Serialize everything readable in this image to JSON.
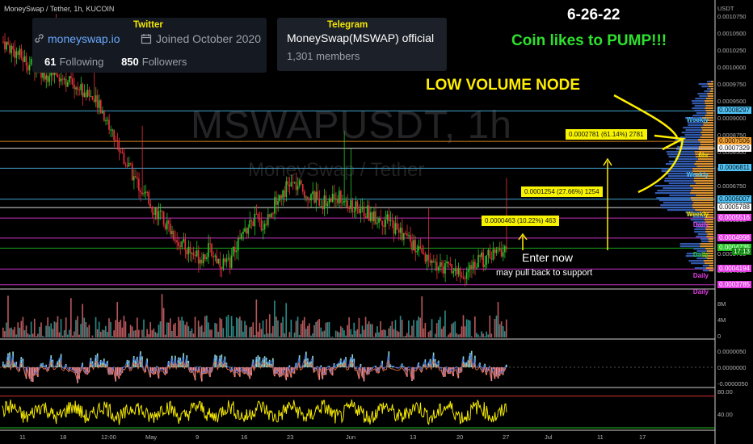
{
  "header": {
    "title": "MoneySwap / Tether, 1h, KUCOIN"
  },
  "twitter": {
    "label": "Twitter",
    "link": "moneyswap.io",
    "joined": "Joined October 2020",
    "following_count": "61",
    "following_label": "Following",
    "followers_count": "850",
    "followers_label": "Followers"
  },
  "telegram": {
    "label": "Telegram",
    "name": "MoneySwap(MSWAP) official",
    "members": "1,301 members"
  },
  "annotations": {
    "date": "6-26-22",
    "tagline": "Coin likes to PUMP!!!",
    "low_volume_node": "LOW VOLUME NODE",
    "enter": "Enter now",
    "pullback": "may pull back to support"
  },
  "watermark": {
    "symbol": "MSWAPUSDT, 1h",
    "name": "MoneySwap / Tether"
  },
  "colors": {
    "background": "#000000",
    "candle_up": "#26c62a",
    "candle_down": "#e8313a",
    "osc_line": "#f5e900",
    "accent_yellow": "#f7f200"
  },
  "chart_data": [
    {
      "type": "candlestick",
      "title": "MSWAPUSDT, 1h",
      "currency": "USDT",
      "x_tick_labels": [
        "11",
        "18",
        "12:00",
        "May",
        "9",
        "16",
        "23",
        "Jun",
        "13",
        "20",
        "27",
        "Jul",
        "11",
        "17"
      ],
      "y_tick_labels": [
        "0.0010750",
        "0.0010500",
        "0.0010250",
        "0.0010000",
        "0.0009750",
        "0.0009500",
        "0.0009000",
        "0.0008750",
        "0.0008500",
        "0.0007000",
        "0.0006750",
        "0.0006500",
        "0.0006250",
        "0.0006000",
        "0.0005750",
        "0.0004000"
      ],
      "ylim": [
        0.00038,
        0.00108
      ],
      "price_path": [
        0.00101,
        0.00099,
        0.00097,
        0.00095,
        0.00094,
        0.00092,
        0.00093,
        0.00091,
        0.0009,
        0.00088,
        0.00086,
        0.00083,
        0.00078,
        0.00073,
        0.00068,
        0.00064,
        0.0006,
        0.00057,
        0.00054,
        0.00051,
        0.00048,
        0.00046,
        0.00045,
        0.00047,
        0.00044,
        0.00043,
        0.00048,
        0.00052,
        0.00055,
        0.00053,
        0.00058,
        0.00062,
        0.00064,
        0.00063,
        0.00061,
        0.0006,
        0.00059,
        0.00061,
        0.0006,
        0.00058,
        0.00057,
        0.00056,
        0.00055,
        0.00054,
        0.00052,
        0.0005,
        0.00047,
        0.00044,
        0.00043,
        0.00042,
        0.00042,
        0.0004,
        0.00042,
        0.00044,
        0.00045,
        0.00046,
        0.00047
      ],
      "levels": [
        {
          "label": "0.0008297",
          "price": 0.0008297,
          "line": "#4fc3f7",
          "tag": ""
        },
        {
          "label": "0.0007506",
          "price": 0.0007506,
          "line": "#f59f2a",
          "tag": ""
        },
        {
          "label": "0.0007329",
          "price": 0.0007329,
          "line": "#ffffff",
          "tag": "6hr"
        },
        {
          "label": "0.0006811",
          "price": 0.0006811,
          "line": "#4fc3f7",
          "tag": "Weekly"
        },
        {
          "label": "0.0006007",
          "price": 0.0006007,
          "line": "#4fc3f7",
          "tag": ""
        },
        {
          "label": "0.0005788",
          "price": 0.0005788,
          "line": "#ffffff",
          "tag": "Weekly"
        },
        {
          "label": "0.0005516",
          "price": 0.0005516,
          "line": "#e33de3",
          "tag": "Daily"
        },
        {
          "label": "0.0004998",
          "price": 0.0004998,
          "line": "#e33de3",
          "tag": ""
        },
        {
          "label": "0.0004735",
          "price": 0.0004735,
          "line": "#22c322",
          "tag": "Daily"
        },
        {
          "label": "0.0004194",
          "price": 0.0004194,
          "line": "#e33de3",
          "tag": "Daily"
        },
        {
          "label": "0.0003785",
          "price": 0.0003785,
          "line": "#e33de3",
          "tag": "Daily"
        }
      ],
      "current_price": {
        "label": "0.0004735",
        "countdown": "17:13"
      },
      "weekly_top_tag": "Weekly",
      "callouts": [
        {
          "text": "0.0002781 (61.14%) 2781"
        },
        {
          "text": "0.0001254 (27.66%) 1254"
        },
        {
          "text": "0.0000463 (10.22%) 463"
        }
      ]
    },
    {
      "type": "bar",
      "title": "Volume",
      "y_tick_labels": [
        "8M",
        "4M",
        "0"
      ],
      "ylim": [
        0,
        8000000
      ]
    },
    {
      "type": "histogram",
      "title": "Oscillator",
      "y_tick_labels": [
        "0.0000050",
        "0.0000000",
        "-0.0000050"
      ],
      "ylim": [
        -5e-06,
        5e-06
      ]
    },
    {
      "type": "line",
      "title": "Oscillator 2",
      "y_tick_labels": [
        "80.00",
        "40.00"
      ],
      "ylim": [
        20,
        90
      ],
      "bands": [
        80,
        20
      ]
    }
  ]
}
